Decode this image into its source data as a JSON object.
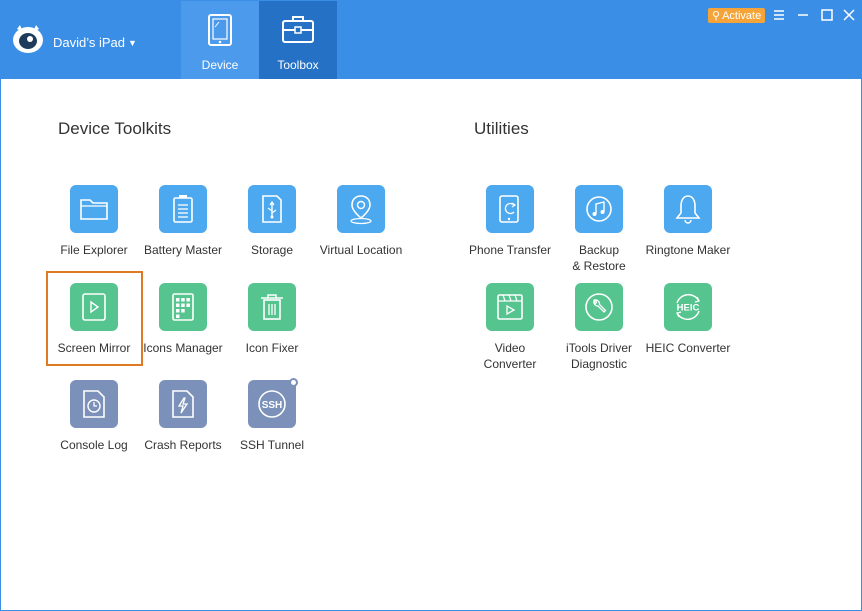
{
  "header": {
    "device_name": "David’s iPad",
    "tabs": [
      {
        "label": "Device"
      },
      {
        "label": "Toolbox"
      }
    ],
    "activate_label": "Activate"
  },
  "sections": {
    "device_toolkits": {
      "title": "Device Toolkits",
      "tools": [
        {
          "label": "File Explorer",
          "color": "#4ca8ef",
          "icon": "folder-icon"
        },
        {
          "label": "Battery Master",
          "color": "#4ca8ef",
          "icon": "battery-icon"
        },
        {
          "label": "Storage",
          "color": "#4ca8ef",
          "icon": "usb-storage-icon"
        },
        {
          "label": "Virtual Location",
          "color": "#4ca8ef",
          "icon": "location-pin-icon"
        },
        {
          "label": "Screen Mirror",
          "color": "#55c48f",
          "icon": "play-screen-icon"
        },
        {
          "label": "Icons Manager",
          "color": "#55c48f",
          "icon": "grid-icon"
        },
        {
          "label": "Icon Fixer",
          "color": "#55c48f",
          "icon": "trash-icon"
        },
        {
          "label": "Console Log",
          "color": "#7b91b9",
          "icon": "clock-doc-icon"
        },
        {
          "label": "Crash Reports",
          "color": "#7b91b9",
          "icon": "bolt-doc-icon"
        },
        {
          "label": "SSH Tunnel",
          "color": "#7b91b9",
          "icon": "ssh-icon",
          "icon_text": "SSH"
        }
      ]
    },
    "utilities": {
      "title": "Utilities",
      "tools": [
        {
          "label": "Phone Transfer",
          "color": "#4ca8ef",
          "icon": "phone-transfer-icon"
        },
        {
          "label": "Backup\n& Restore",
          "color": "#4ca8ef",
          "icon": "music-backup-icon"
        },
        {
          "label": "Ringtone Maker",
          "color": "#4ca8ef",
          "icon": "bell-icon"
        },
        {
          "label": "Video\nConverter",
          "color": "#55c48f",
          "icon": "video-icon"
        },
        {
          "label": "iTools Driver\nDiagnostic",
          "color": "#55c48f",
          "icon": "wrench-icon"
        },
        {
          "label": "HEIC Converter",
          "color": "#55c48f",
          "icon": "heic-icon",
          "icon_text": "HEIC"
        }
      ]
    }
  },
  "highlighted_tool": "Screen Mirror"
}
